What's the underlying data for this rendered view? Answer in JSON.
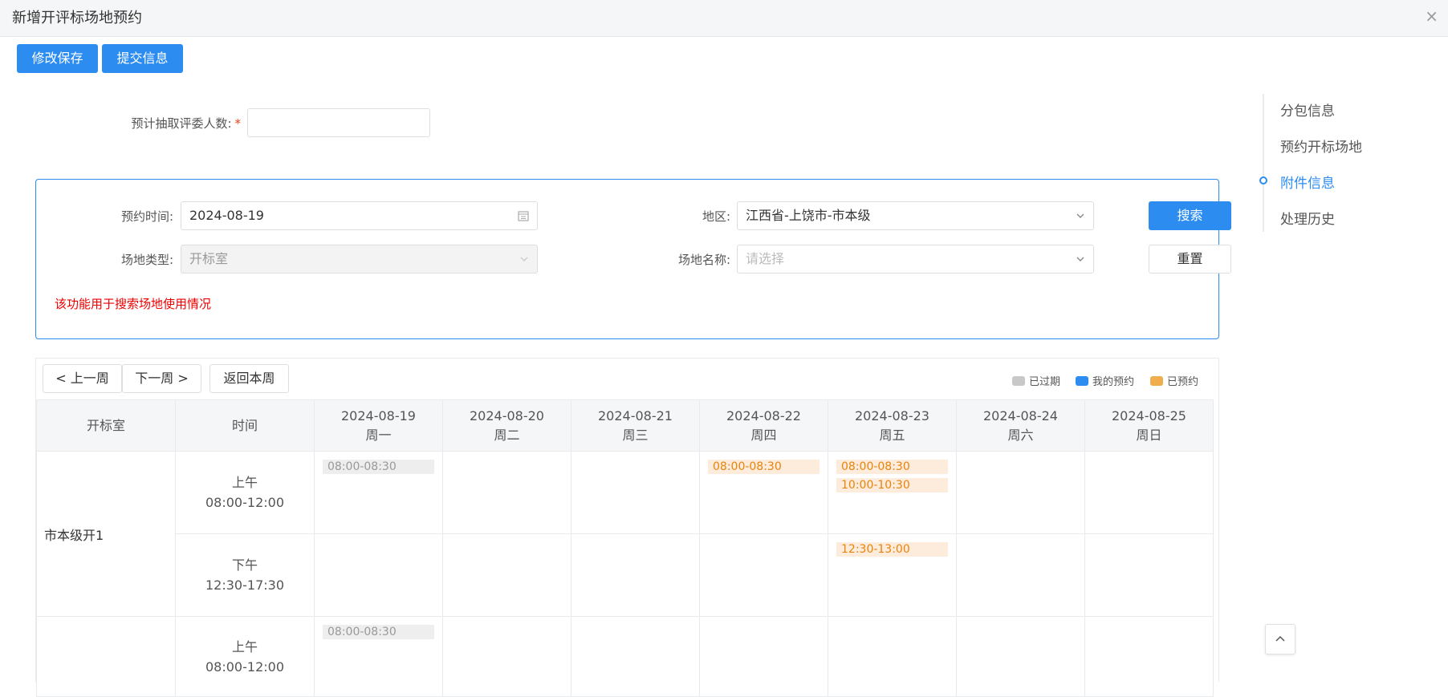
{
  "window": {
    "title": "新增开评标场地预约",
    "close_glyph": "×"
  },
  "toolbar": {
    "save_label": "修改保存",
    "submit_label": "提交信息"
  },
  "form": {
    "reviewer_count_label": "预计抽取评委人数:",
    "required_mark": "*",
    "reviewer_count_value": ""
  },
  "search": {
    "time_label": "预约时间:",
    "time_value": "2024-08-19",
    "region_label": "地区:",
    "region_value": "江西省-上饶市-市本级",
    "venue_type_label": "场地类型:",
    "venue_type_value": "开标室",
    "venue_name_label": "场地名称:",
    "venue_name_placeholder": "请选择",
    "search_button": "搜索",
    "reset_button": "重置",
    "hint": "该功能用于搜索场地使用情况"
  },
  "anchor_nav": {
    "items": [
      "分包信息",
      "预约开标场地",
      "附件信息",
      "处理历史"
    ],
    "active_index": 2
  },
  "calendar_nav": {
    "prev_week": "< 上一周",
    "next_week": "下一周 >",
    "this_week": "返回本周"
  },
  "legend": [
    {
      "label": "已过期",
      "color": "#c8c8c8"
    },
    {
      "label": "我的预约",
      "color": "#2d8cf0"
    },
    {
      "label": "已预约",
      "color": "#f0ad4e"
    }
  ],
  "table": {
    "room_header": "开标室",
    "time_header": "时间",
    "days": [
      {
        "date": "2024-08-19",
        "weekday": "周一"
      },
      {
        "date": "2024-08-20",
        "weekday": "周二"
      },
      {
        "date": "2024-08-21",
        "weekday": "周三"
      },
      {
        "date": "2024-08-22",
        "weekday": "周四"
      },
      {
        "date": "2024-08-23",
        "weekday": "周五"
      },
      {
        "date": "2024-08-24",
        "weekday": "周六"
      },
      {
        "date": "2024-08-25",
        "weekday": "周日"
      }
    ],
    "rooms": [
      {
        "name": "市本级开1",
        "periods": [
          {
            "label": "上午",
            "range": "08:00-12:00",
            "slots": [
              [
                {
                  "text": "08:00-08:30",
                  "status": "expired"
                }
              ],
              [],
              [],
              [
                {
                  "text": "08:00-08:30",
                  "status": "booked"
                }
              ],
              [
                {
                  "text": "08:00-08:30",
                  "status": "booked"
                },
                {
                  "text": "10:00-10:30",
                  "status": "booked"
                }
              ],
              [],
              []
            ]
          },
          {
            "label": "下午",
            "range": "12:30-17:30",
            "slots": [
              [],
              [],
              [],
              [],
              [
                {
                  "text": "12:30-13:00",
                  "status": "booked"
                }
              ],
              [],
              []
            ]
          }
        ]
      },
      {
        "name": "",
        "periods": [
          {
            "label": "上午",
            "range": "08:00-12:00",
            "slots": [
              [
                {
                  "text": "08:00-08:30",
                  "status": "expired"
                }
              ],
              [],
              [],
              [],
              [],
              [],
              []
            ]
          }
        ]
      }
    ]
  },
  "back_to_top_icon": "chevron-up-icon"
}
